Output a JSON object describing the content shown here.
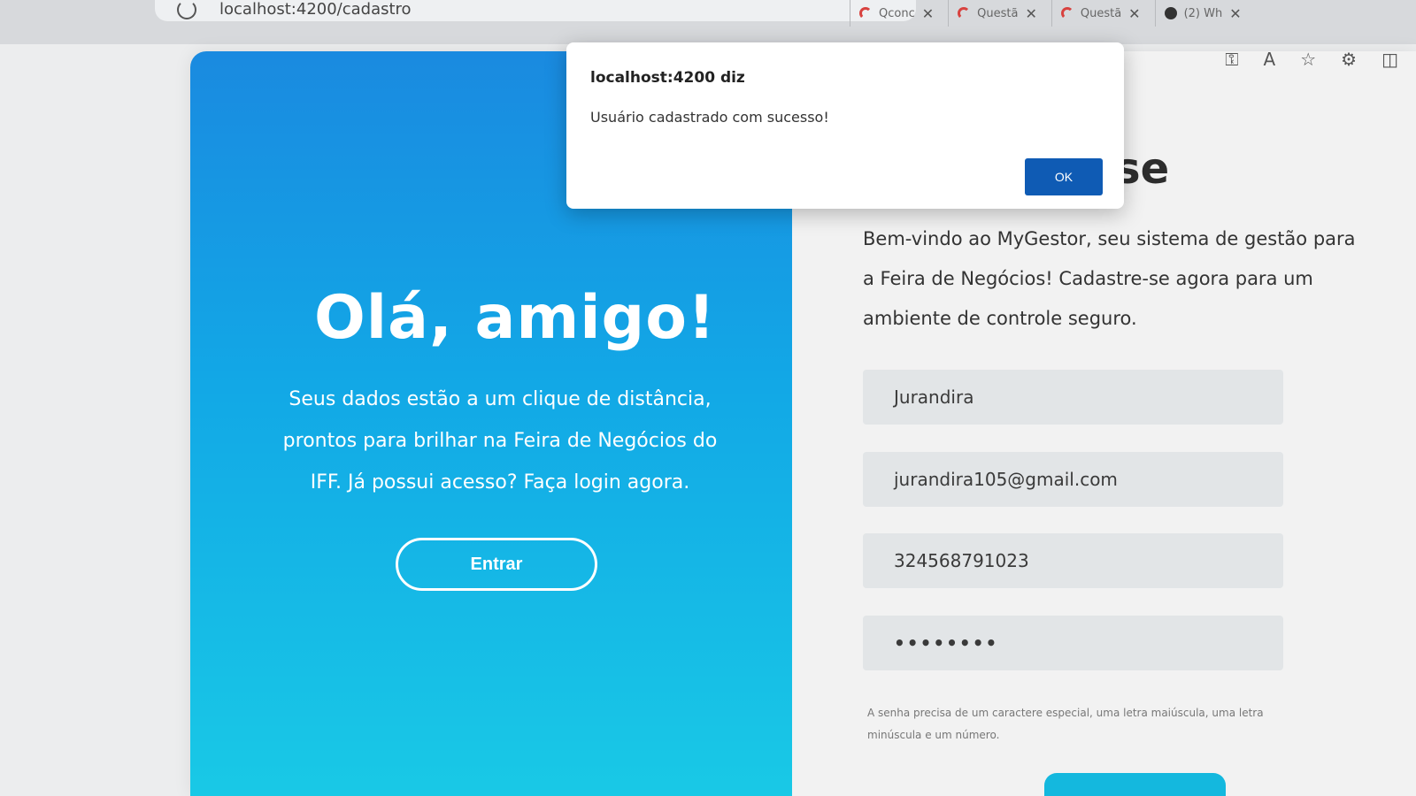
{
  "browser": {
    "address": "localhost:4200/cadastro",
    "tabs": [
      {
        "label": "Qconc",
        "icon": "qconcursos-icon"
      },
      {
        "label": "Questã",
        "icon": "questao-icon"
      },
      {
        "label": "Questã",
        "icon": "questao-icon"
      },
      {
        "label": "(2) Wh",
        "icon": "whatsapp-icon"
      }
    ],
    "toolbar_icons": [
      "key-icon",
      "read-aloud-icon",
      "favorite-star-icon",
      "extensions-icon",
      "split-screen-icon"
    ]
  },
  "left_panel": {
    "heading": "Olá, amigo!",
    "subtitle": "Seus dados estão a um clique de distância, prontos para brilhar na Feira de Negócios do IFF. Já possui acesso? Faça login agora.",
    "login_button": "Entrar",
    "colors": {
      "top": "#1a8ae0",
      "bottom": "#19c9e6"
    }
  },
  "right_panel": {
    "title_fragment": "se",
    "welcome": "Bem-vindo ao MyGestor, seu sistema de gestão para a Feira de Negócios! Cadastre-se agora para um ambiente de controle seguro.",
    "fields": {
      "name": "Jurandira",
      "email": "jurandira105@gmail.com",
      "phone": "324568791023",
      "password_mask": "••••••••"
    },
    "password_hint": "A senha precisa de um caractere especial, uma letra maiúscula, uma letra minúscula e um número."
  },
  "dialog": {
    "title": "localhost:4200 diz",
    "message": "Usuário cadastrado com sucesso!",
    "ok_label": "OK",
    "ok_color": "#0f5bb4"
  }
}
